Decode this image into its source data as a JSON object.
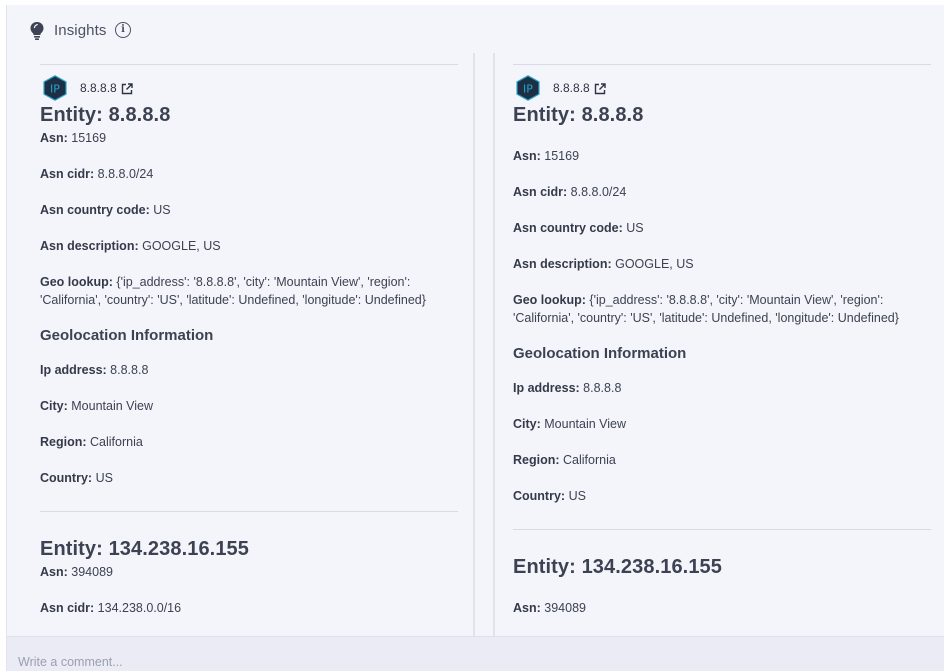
{
  "header": {
    "title": "Insights",
    "icon": "lightbulb-icon",
    "info_icon": "info-icon"
  },
  "columns": [
    {
      "ip_badge": "IP",
      "ip_link": "8.8.8.8",
      "entity1": {
        "title": "Entity: 8.8.8.8",
        "asn_label": "Asn:",
        "asn": "15169",
        "asn_cidr_label": "Asn cidr:",
        "asn_cidr": "8.8.8.0/24",
        "asn_cc_label": "Asn country code:",
        "asn_cc": "US",
        "asn_desc_label": "Asn description:",
        "asn_desc": "GOOGLE, US",
        "geo_label": "Geo lookup:",
        "geo_line1": "{'ip_address': '8.8.8.8', 'city': 'Mountain View', 'region':",
        "geo_line2": "'California', 'country': 'US', 'latitude': Undefined, 'longitude': Undefined}",
        "geo_section": "Geolocation Information",
        "ip_addr_label": "Ip address:",
        "ip_addr": "8.8.8.8",
        "city_label": "City:",
        "city": "Mountain View",
        "region_label": "Region:",
        "region": "California",
        "country_label": "Country:",
        "country": "US"
      },
      "entity2": {
        "title": "Entity: 134.238.16.155",
        "asn_label": "Asn:",
        "asn": "394089",
        "asn_cidr_label": "Asn cidr:",
        "asn_cidr": "134.238.0.0/16"
      }
    },
    {
      "ip_badge": "IP",
      "ip_link": "8.8.8.8",
      "entity1": {
        "title": "Entity: 8.8.8.8",
        "asn_label": "Asn:",
        "asn": "15169",
        "asn_cidr_label": "Asn cidr:",
        "asn_cidr": "8.8.8.0/24",
        "asn_cc_label": "Asn country code:",
        "asn_cc": "US",
        "asn_desc_label": "Asn description:",
        "asn_desc": "GOOGLE, US",
        "geo_label": "Geo lookup:",
        "geo_line1": "{'ip_address': '8.8.8.8', 'city': 'Mountain View', 'region':",
        "geo_line2": "'California', 'country': 'US', 'latitude': Undefined, 'longitude': Undefined}",
        "geo_section": "Geolocation Information",
        "ip_addr_label": "Ip address:",
        "ip_addr": "8.8.8.8",
        "city_label": "City:",
        "city": "Mountain View",
        "region_label": "Region:",
        "region": "California",
        "country_label": "Country:",
        "country": "US"
      },
      "entity2": {
        "title": "Entity: 134.238.16.155",
        "asn_label": "Asn:",
        "asn": "394089"
      }
    }
  ],
  "footer": {
    "comment_placeholder": "Write a comment..."
  },
  "colors": {
    "background": "#f4f5fa",
    "badge_fill": "#1d2f45",
    "badge_accent": "#2aa3c9",
    "text": "#3c4252"
  }
}
